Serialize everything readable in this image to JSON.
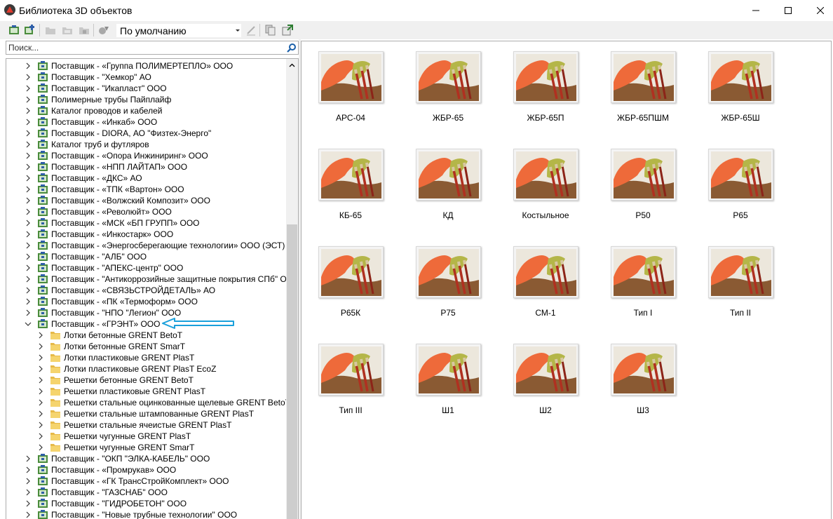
{
  "window": {
    "title": "Библиотека 3D объектов",
    "controls": {
      "minimize": "minimize",
      "maximize": "maximize",
      "close": "close"
    }
  },
  "toolbar": {
    "view_select_value": "По умолчанию"
  },
  "search": {
    "placeholder": "Поиск..."
  },
  "tree": {
    "rows": [
      {
        "label": "Поставщик - «Группа ПОЛИМЕРТЕПЛО» ООО",
        "level": 0,
        "expanded": false
      },
      {
        "label": "Поставщик - \"Хемкор\" АО",
        "level": 0,
        "expanded": false
      },
      {
        "label": "Поставщик - \"Икапласт\" ООО",
        "level": 0,
        "expanded": false
      },
      {
        "label": "Полимерные трубы Пайплайф",
        "level": 0,
        "expanded": false
      },
      {
        "label": "Каталог проводов и кабелей",
        "level": 0,
        "expanded": false
      },
      {
        "label": "Поставщик - «Инкаб» ООО",
        "level": 0,
        "expanded": false
      },
      {
        "label": "Поставщик - DIORA, АО \"Физтех-Энерго\"",
        "level": 0,
        "expanded": false
      },
      {
        "label": "Каталог труб и футляров",
        "level": 0,
        "expanded": false
      },
      {
        "label": "Поставщик - «Опора Инжиниринг» ООО",
        "level": 0,
        "expanded": false
      },
      {
        "label": "Поставщик - «НПП ЛАЙТАП» ООО",
        "level": 0,
        "expanded": false
      },
      {
        "label": "Поставщик - «ДКС» АО",
        "level": 0,
        "expanded": false
      },
      {
        "label": "Поставщик - «ТПК «Вартон» ООО",
        "level": 0,
        "expanded": false
      },
      {
        "label": "Поставщик - «Волжский Композит» ООО",
        "level": 0,
        "expanded": false
      },
      {
        "label": "Поставщик - «Революйт» ООО",
        "level": 0,
        "expanded": false
      },
      {
        "label": "Поставщик - «МСК «БП ГРУПП» ООО",
        "level": 0,
        "expanded": false
      },
      {
        "label": "Поставщик - «Инкостарк» ООО",
        "level": 0,
        "expanded": false
      },
      {
        "label": "Поставщик - «Энергосберегающие технологии» ООО (ЭСТ)",
        "level": 0,
        "expanded": false
      },
      {
        "label": "Поставщик - \"АЛБ\" ООО",
        "level": 0,
        "expanded": false
      },
      {
        "label": "Поставщик - \"АПЕКС-центр\" ООО",
        "level": 0,
        "expanded": false
      },
      {
        "label": "Поставщик - \"Антикоррозийные защитные покрытия СПб\" ООО",
        "level": 0,
        "expanded": false
      },
      {
        "label": "Поставщик - «СВЯЗЬСТРОЙДЕТАЛЬ» АО",
        "level": 0,
        "expanded": false
      },
      {
        "label": "Поставщик - «ПК «Термоформ» ООО",
        "level": 0,
        "expanded": false
      },
      {
        "label": "Поставщик - \"НПО \"Легион\" ООО",
        "level": 0,
        "expanded": false
      },
      {
        "label": "Поставщик - «ГРЭНТ» ООО",
        "level": 0,
        "expanded": true
      },
      {
        "label": "Лотки бетонные GRENT BetoT",
        "level": 1,
        "expanded": false
      },
      {
        "label": "Лотки бетонные GRENT SmarT",
        "level": 1,
        "expanded": false
      },
      {
        "label": "Лотки пластиковые GRENT PlasT",
        "level": 1,
        "expanded": false
      },
      {
        "label": "Лотки пластиковые GRENT PlasT EcoZ",
        "level": 1,
        "expanded": false
      },
      {
        "label": "Решетки бетонные GRENT BetoT",
        "level": 1,
        "expanded": false
      },
      {
        "label": "Решетки пластиковые GRENT PlasT",
        "level": 1,
        "expanded": false
      },
      {
        "label": "Решетки стальные оцинкованные щелевые GRENT BetoT",
        "level": 1,
        "expanded": false
      },
      {
        "label": "Решетки стальные штампованные GRENT PlasT",
        "level": 1,
        "expanded": false
      },
      {
        "label": "Решетки стальные ячеистые GRENT PlasT",
        "level": 1,
        "expanded": false
      },
      {
        "label": "Решетки чугунные GRENT PlasT",
        "level": 1,
        "expanded": false
      },
      {
        "label": "Решетки чугунные GRENT SmarT",
        "level": 1,
        "expanded": false
      },
      {
        "label": "Поставщик - \"ОКП \"ЭЛКА-КАБЕЛЬ\" ООО",
        "level": 0,
        "expanded": false
      },
      {
        "label": "Поставщик - «Промрукав» ООО",
        "level": 0,
        "expanded": false
      },
      {
        "label": "Поставщик - «ГК ТрансСтройКомплект» ООО",
        "level": 0,
        "expanded": false
      },
      {
        "label": "Поставщик - \"ГАЗСНАБ\" ООО",
        "level": 0,
        "expanded": false
      },
      {
        "label": "Поставщик - \"ГИДРОБЕТОН\" ООО",
        "level": 0,
        "expanded": false
      },
      {
        "label": "Поставщик - \"Новые трубные технологии\" ООО",
        "level": 0,
        "expanded": false
      }
    ]
  },
  "annotation": {
    "color": "#1aa0db"
  },
  "grid": {
    "items": [
      {
        "label": "АРС-04"
      },
      {
        "label": "ЖБР-65"
      },
      {
        "label": "ЖБР-65П"
      },
      {
        "label": "ЖБР-65ПШМ"
      },
      {
        "label": "ЖБР-65Ш"
      },
      {
        "label": "КБ-65"
      },
      {
        "label": "КД"
      },
      {
        "label": "Костыльное"
      },
      {
        "label": "Р50"
      },
      {
        "label": "Р65"
      },
      {
        "label": "Р65К"
      },
      {
        "label": "Р75"
      },
      {
        "label": "СМ-1"
      },
      {
        "label": "Тип I"
      },
      {
        "label": "Тип II"
      },
      {
        "label": "Тип III"
      },
      {
        "label": "Ш1"
      },
      {
        "label": "Ш2"
      },
      {
        "label": "Ш3"
      }
    ]
  }
}
